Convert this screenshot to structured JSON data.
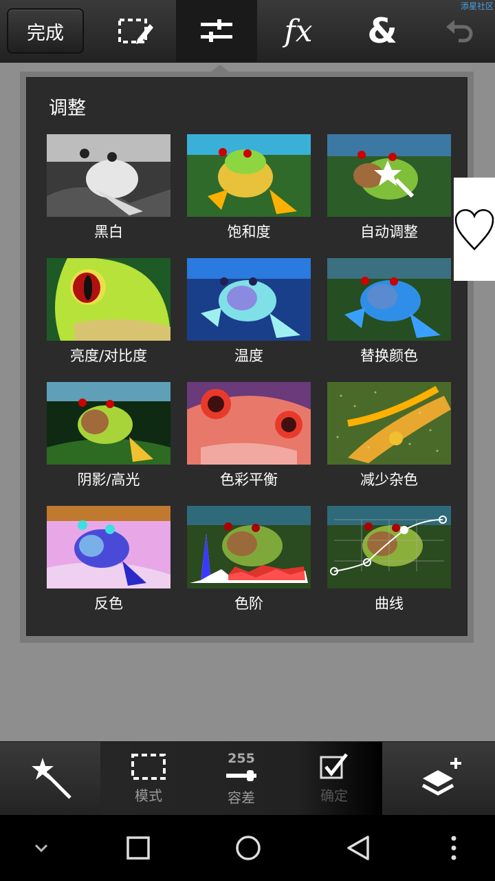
{
  "watermark": "添星社区",
  "toolbar": {
    "done_label": "完成",
    "icons": [
      "selection-edit-icon",
      "adjust-sliders-icon",
      "effects-fx-icon",
      "ampersand-icon",
      "undo-icon"
    ],
    "fx_label": "fx",
    "amp_label": "&"
  },
  "panel": {
    "title": "调整",
    "items": [
      {
        "label": "黑白"
      },
      {
        "label": "饱和度"
      },
      {
        "label": "自动调整"
      },
      {
        "label": "亮度/对比度"
      },
      {
        "label": "温度"
      },
      {
        "label": "替换颜色"
      },
      {
        "label": "阴影/高光"
      },
      {
        "label": "色彩平衡"
      },
      {
        "label": "减少杂色"
      },
      {
        "label": "反色"
      },
      {
        "label": "色阶"
      },
      {
        "label": "曲线"
      }
    ]
  },
  "side": {
    "icon": "heart-icon"
  },
  "bottom": {
    "wand_icon": "magic-wand-icon",
    "mode_label": "模式",
    "tolerance_value": "255",
    "tolerance_label": "容差",
    "confirm_label": "确定",
    "layers_icon": "layers-add-icon"
  },
  "nav": {
    "icons": [
      "chevron-down-icon",
      "recents-square-icon",
      "home-circle-icon",
      "back-triangle-icon",
      "more-dots-icon"
    ]
  },
  "colors": {
    "background": "#8e8e8e",
    "panel": "#2b2b2b",
    "toolbar": "#2a2a2a",
    "watermark": "#4aa0e0"
  }
}
